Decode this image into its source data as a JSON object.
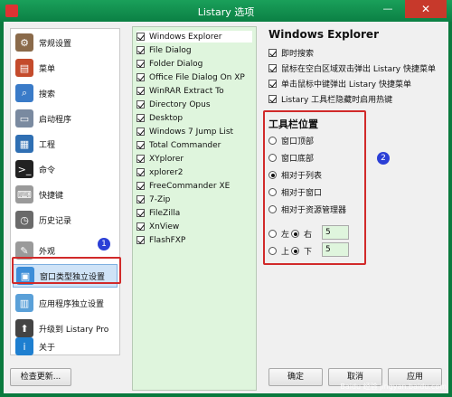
{
  "window": {
    "title": "Listary 选项",
    "min_symbol": "—",
    "close_symbol": "✕"
  },
  "sidebar": {
    "items": [
      {
        "label": "常规设置",
        "icon": "general-settings-icon",
        "color": "#8a6a4a"
      },
      {
        "label": "菜单",
        "icon": "menu-icon",
        "color": "#c44b2c"
      },
      {
        "label": "搜索",
        "icon": "search-icon",
        "color": "#3a7bc8"
      },
      {
        "label": "启动程序",
        "icon": "launcher-icon",
        "color": "#7a8aa0"
      },
      {
        "label": "工程",
        "icon": "project-icon",
        "color": "#2f6fb3"
      },
      {
        "label": "命令",
        "icon": "command-icon",
        "color": "#222222"
      },
      {
        "label": "快捷键",
        "icon": "keyboard-icon",
        "color": "#9a9a9a"
      },
      {
        "label": "历史记录",
        "icon": "history-icon",
        "color": "#6a6a6a"
      },
      {
        "label": "外观",
        "icon": "appearance-icon",
        "color": "#9a9a9a"
      },
      {
        "label": "窗口类型独立设置",
        "icon": "window-type-icon",
        "color": "#3c8dd8"
      },
      {
        "label": "应用程序独立设置",
        "icon": "app-settings-icon",
        "color": "#5aa0d8"
      },
      {
        "label": "升级到 Listary Pro",
        "icon": "upgrade-icon",
        "color": "#444444"
      },
      {
        "label": "关于",
        "icon": "about-icon",
        "color": "#1e7fd0"
      }
    ],
    "active_index": 9
  },
  "window_types": [
    {
      "label": "Windows Explorer",
      "checked": true
    },
    {
      "label": "File Dialog",
      "checked": true
    },
    {
      "label": "Folder Dialog",
      "checked": true
    },
    {
      "label": "Office File Dialog On XP",
      "checked": true
    },
    {
      "label": "WinRAR Extract To",
      "checked": true
    },
    {
      "label": "Directory Opus",
      "checked": true
    },
    {
      "label": "Desktop",
      "checked": true
    },
    {
      "label": "Windows 7 Jump List",
      "checked": true
    },
    {
      "label": "Total Commander",
      "checked": true
    },
    {
      "label": "XYplorer",
      "checked": true
    },
    {
      "label": "xplorer2",
      "checked": true
    },
    {
      "label": "FreeCommander XE",
      "checked": true
    },
    {
      "label": "7-Zip",
      "checked": true
    },
    {
      "label": "FileZilla",
      "checked": true
    },
    {
      "label": "XnView",
      "checked": true
    },
    {
      "label": "FlashFXP",
      "checked": true
    }
  ],
  "settings": {
    "title": "Windows Explorer",
    "checkboxes": [
      {
        "label": "即时搜索",
        "checked": true
      },
      {
        "label": "鼠标在空白区域双击弹出 Listary 快捷菜单",
        "checked": true
      },
      {
        "label": "单击鼠标中键弹出 Listary 快捷菜单",
        "checked": true
      },
      {
        "label": "Listary 工具栏隐藏时启用热键",
        "checked": true
      }
    ],
    "toolbar_title": "工具栏位置",
    "positions": [
      {
        "label": "窗口顶部",
        "selected": false
      },
      {
        "label": "窗口底部",
        "selected": false
      },
      {
        "label": "相对于列表",
        "selected": true
      },
      {
        "label": "相对于窗口",
        "selected": false
      },
      {
        "label": "相对于资源管理器",
        "selected": false
      }
    ],
    "offset": {
      "left_label": "左",
      "right_label": "右",
      "right_selected": true,
      "x_value": "5",
      "top_label": "上",
      "bottom_label": "下",
      "bottom_selected": true,
      "y_value": "5"
    }
  },
  "badges": {
    "one": "1",
    "two": "2"
  },
  "buttons": {
    "check_updates": "检查更新...",
    "ok": "确定",
    "cancel": "取消",
    "apply": "应用"
  },
  "watermark": "Baidu 经验 jingyan.baidu.com",
  "colors": {
    "title_bar": "#0b8044",
    "highlight_red": "#d12a2a",
    "badge_blue": "#2b3fd6",
    "list_bg": "#dff5dd"
  }
}
